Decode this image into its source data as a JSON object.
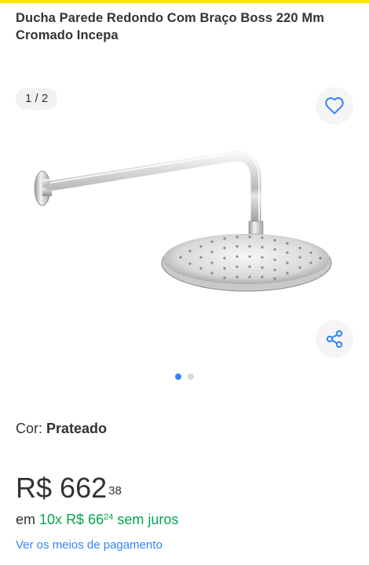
{
  "product": {
    "title": "Ducha Parede Redondo Com Braço Boss  220 Mm Cromado Incepa"
  },
  "gallery": {
    "counter": "1 / 2",
    "current_index": 1,
    "total": 2,
    "favorite_icon": "heart-outline-icon",
    "share_icon": "share-icon"
  },
  "variation": {
    "label": "Cor: ",
    "value": "Prateado"
  },
  "price": {
    "currency": "R$",
    "integer": "662",
    "cents": "38"
  },
  "installments": {
    "prefix": "em ",
    "count": "10x",
    "amount_integer": "R$ 66",
    "amount_cents": "24",
    "suffix": " sem juros"
  },
  "payment_link": "Ver os meios de pagamento",
  "colors": {
    "accent_yellow": "#FFE600",
    "link_blue": "#3483fa",
    "green": "#00a650"
  }
}
